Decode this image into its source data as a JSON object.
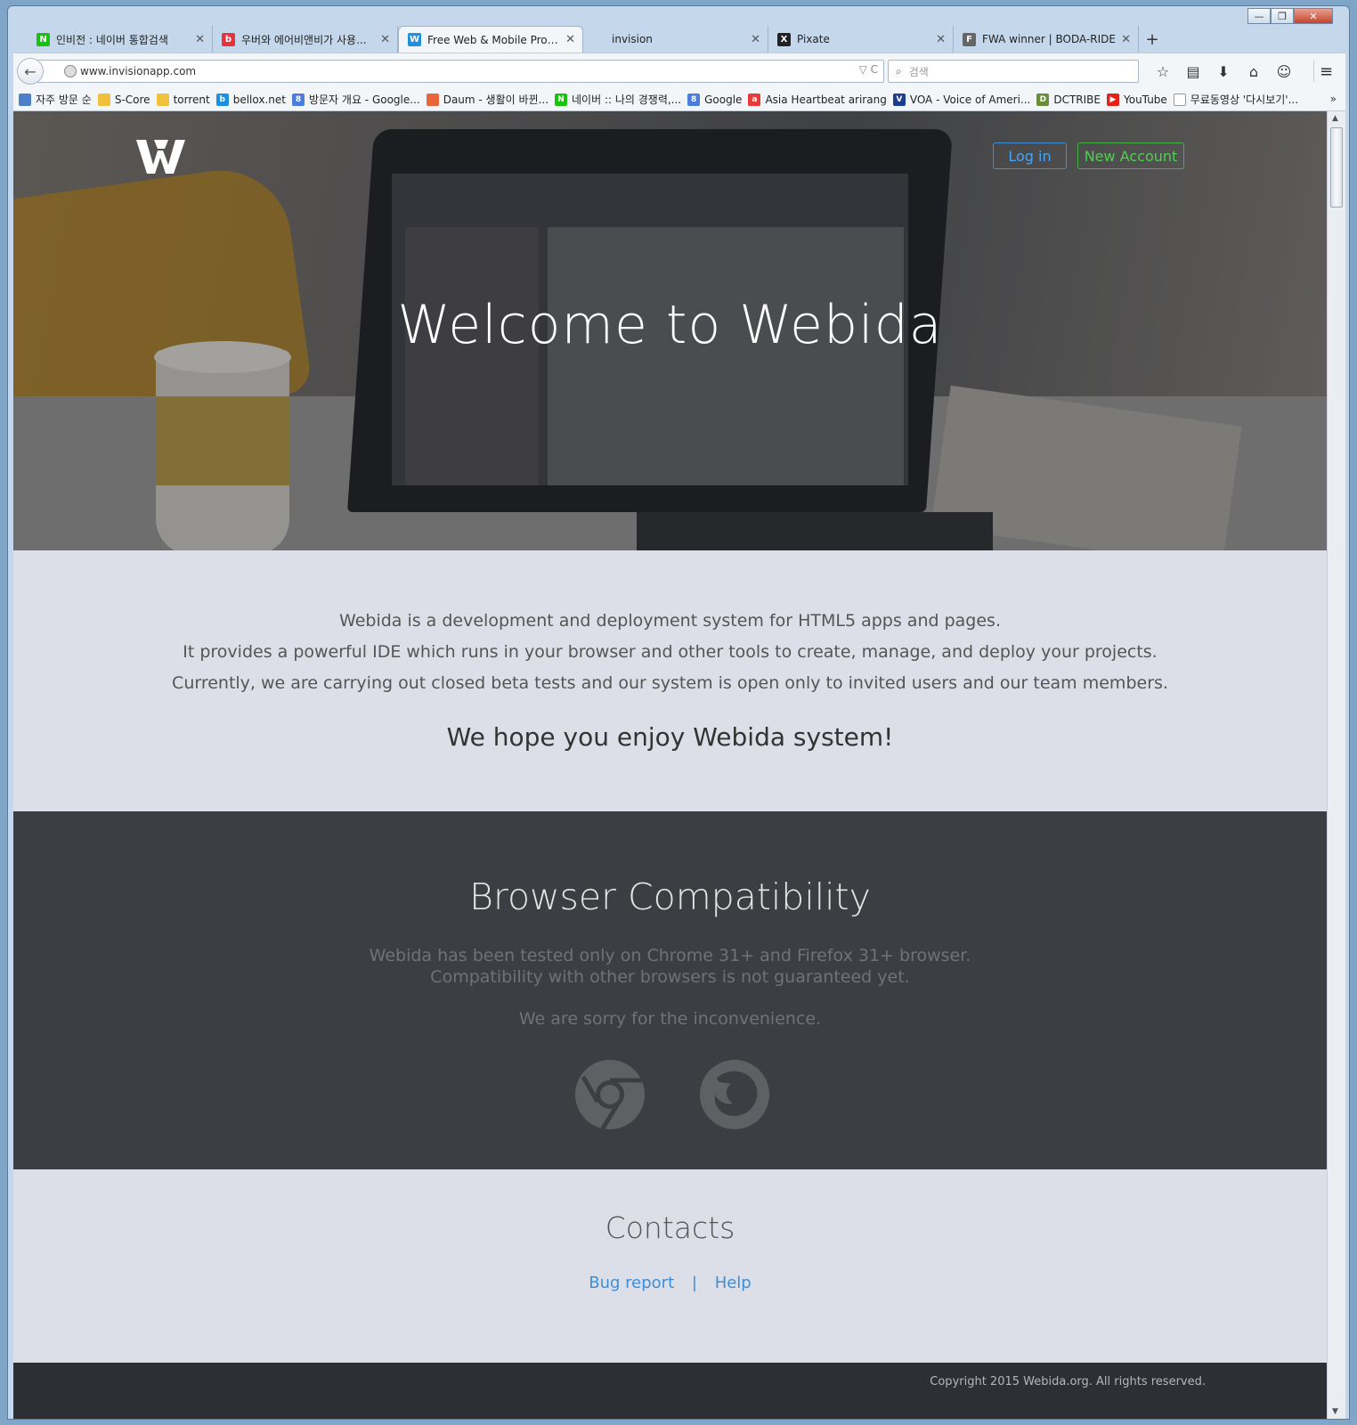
{
  "window": {
    "minimize": "—",
    "maximize": "❐",
    "close": "✕"
  },
  "tabs": [
    {
      "label": "인비전 : 네이버 통합검색",
      "icon": "naver-icon",
      "color": "#19c20b",
      "glyph": "N"
    },
    {
      "label": "우버와 에어비앤비가 사용...",
      "icon": "b-icon",
      "color": "#e8333a",
      "glyph": "b"
    },
    {
      "label": "Free Web & Mobile Proto...",
      "icon": "webida-icon",
      "color": "#1e90e0",
      "glyph": "W"
    },
    {
      "label": "invision",
      "icon": "blank-icon",
      "color": "transparent",
      "glyph": ""
    },
    {
      "label": "Pixate",
      "icon": "pixate-icon",
      "color": "#222222",
      "glyph": "X"
    },
    {
      "label": "FWA winner | BODA-RIDE",
      "icon": "fwa-icon",
      "color": "#666666",
      "glyph": "F"
    }
  ],
  "tab_close": "✕",
  "new_tab": "+",
  "navbar": {
    "back": "←",
    "url": "www.invisionapp.com",
    "url_controls": "▽ C",
    "search_placeholder": "검색",
    "search_glyph": "⌕",
    "icons": [
      "☆",
      "▤",
      "⬇",
      "⌂",
      "☺"
    ],
    "menu": "≡"
  },
  "bookmarks": [
    {
      "label": "자주 방문 순",
      "color": "#4b7fc8",
      "glyph": ""
    },
    {
      "label": "S-Core",
      "color": "#f0c23b",
      "glyph": ""
    },
    {
      "label": "torrent",
      "color": "#f0c23b",
      "glyph": ""
    },
    {
      "label": "bellox.net",
      "color": "#1e90e0",
      "glyph": "b"
    },
    {
      "label": "방문자 개요 - Google...",
      "color": "#4a7ddc",
      "glyph": "8"
    },
    {
      "label": "Daum - 생활이 바뀐...",
      "color": "#e8663a",
      "glyph": ""
    },
    {
      "label": "네이버 :: 나의 경쟁력,...",
      "color": "#19c20b",
      "glyph": "N"
    },
    {
      "label": "Google",
      "color": "#4a7ddc",
      "glyph": "8"
    },
    {
      "label": "Asia Heartbeat arirang",
      "color": "#e83a3a",
      "glyph": "a"
    },
    {
      "label": "VOA - Voice of Ameri...",
      "color": "#1d3d8f",
      "glyph": "V"
    },
    {
      "label": "DCTRIBE",
      "color": "#6b8c3a",
      "glyph": "D"
    },
    {
      "label": "YouTube",
      "color": "#e62117",
      "glyph": "▶"
    },
    {
      "label": "무료동영상 '다시보기'...",
      "color": "#ffffff",
      "glyph": ""
    }
  ],
  "bookmarks_more": "»",
  "page": {
    "hero_title": "Welcome to Webida",
    "login": "Log in",
    "new_account": "New Account",
    "intro_lines": [
      "Webida is a development and deployment system for HTML5 apps and pages.",
      "It provides a powerful IDE which runs in your browser and other tools to create, manage, and deploy your projects.",
      "Currently, we are carrying out closed beta tests and our system is open only to invited users and our team members."
    ],
    "hope": "We hope you enjoy Webida system!",
    "compat_title": "Browser Compatibility",
    "compat_lines": [
      "Webida has been tested only on Chrome 31+ and Firefox 31+ browser.",
      "Compatibility with other browsers is not guaranteed yet."
    ],
    "compat_sorry": "We are sorry for the inconvenience.",
    "contacts_title": "Contacts",
    "bug_report": "Bug report",
    "separator": "|",
    "help": "Help",
    "copyright": "Copyright 2015 Webida.org. All rights reserved."
  },
  "colors": {
    "login_border": "#3b8fd9",
    "new_account": "#3fb43f",
    "compat_bg": "#3b3e42",
    "footer_bg": "#2c2f33",
    "link": "#3b8fd9"
  }
}
